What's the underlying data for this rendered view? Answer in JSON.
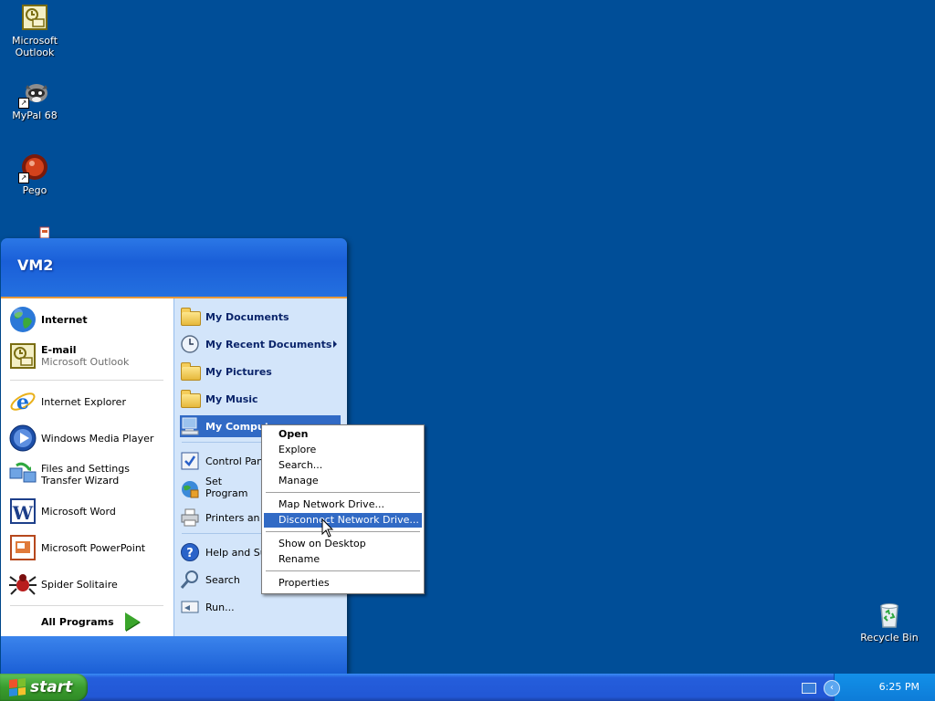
{
  "desktop": {
    "icons": [
      {
        "label_line1": "Microsoft",
        "label_line2": "Outlook"
      },
      {
        "label_line1": "MyPal 68",
        "label_line2": ""
      },
      {
        "label_line1": "Pego",
        "label_line2": ""
      },
      {
        "label_line1": "Recycle Bin",
        "label_line2": ""
      }
    ]
  },
  "start_menu": {
    "user_name": "VM2",
    "pinned": [
      {
        "title": "Internet",
        "subtitle": ""
      },
      {
        "title": "E-mail",
        "subtitle": "Microsoft Outlook"
      }
    ],
    "recent": [
      {
        "label": "Internet Explorer"
      },
      {
        "label": "Windows Media Player"
      },
      {
        "label": "Files and Settings Transfer Wizard"
      },
      {
        "label": "Microsoft Word"
      },
      {
        "label": "Microsoft PowerPoint"
      },
      {
        "label": "Spider Solitaire"
      }
    ],
    "all_programs": "All Programs",
    "right_items": [
      {
        "label": "My Documents"
      },
      {
        "label": "My Recent Documents"
      },
      {
        "label": "My Pictures"
      },
      {
        "label": "My Music"
      },
      {
        "label": "My Computer"
      },
      {
        "label": "Control Panel"
      },
      {
        "label": "Set Program Access and Defaults"
      },
      {
        "label": "Printers and Faxes"
      },
      {
        "label": "Help and Support"
      },
      {
        "label": "Search"
      },
      {
        "label": "Run..."
      }
    ]
  },
  "context_menu": {
    "items": [
      {
        "label": "Open"
      },
      {
        "label": "Explore"
      },
      {
        "label": "Search..."
      },
      {
        "label": "Manage"
      },
      {
        "label": "Map Network Drive..."
      },
      {
        "label": "Disconnect Network Drive..."
      },
      {
        "label": "Show on Desktop"
      },
      {
        "label": "Rename"
      },
      {
        "label": "Properties"
      }
    ],
    "highlighted": "Disconnect Network Drive..."
  },
  "taskbar": {
    "start_label": "start",
    "clock": "6:25 PM"
  },
  "colors": {
    "desktop": "#004e98",
    "selection": "#316ac5",
    "start_green": "#3a9c2e"
  }
}
